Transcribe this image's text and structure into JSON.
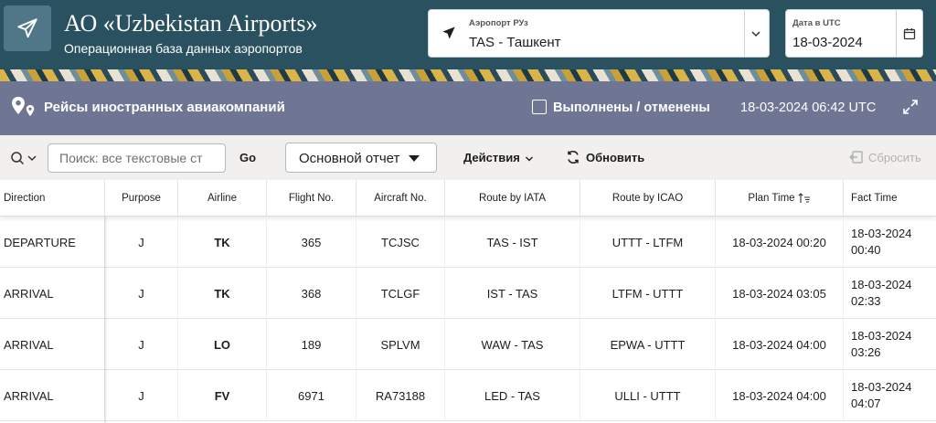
{
  "header": {
    "title": "АО «Uzbekistan Airports»",
    "subtitle": "Операционная база данных аэропортов",
    "airport_label": "Аэропорт РУз",
    "airport_value": "TAS - Ташкент",
    "date_label": "Дата в UTC",
    "date_value": "18-03-2024"
  },
  "region": {
    "title": "Рейсы иностранных авиакомпаний",
    "checkbox_label": "Выполнены / отменены",
    "datetime": "18-03-2024 06:42 UTC"
  },
  "toolbar": {
    "search_placeholder": "Поиск: все текстовые ст",
    "go_label": "Go",
    "report_value": "Основной отчет",
    "actions_label": "Действия",
    "refresh_label": "Обновить",
    "reset_label": "Сбросить"
  },
  "table": {
    "columns": [
      "Direction",
      "Purpose",
      "Airline",
      "Flight No.",
      "Aircraft No.",
      "Route by IATA",
      "Route by ICAO",
      "Plan Time",
      "Fact Time"
    ],
    "rows": [
      {
        "direction": "DEPARTURE",
        "purpose": "J",
        "airline": "TK",
        "flight": "365",
        "aircraft": "TCJSC",
        "iata": "TAS - IST",
        "icao": "UTTT - LTFM",
        "plan": "18-03-2024 00:20",
        "fact_date": "18-03-2024",
        "fact_time": "00:40"
      },
      {
        "direction": "ARRIVAL",
        "purpose": "J",
        "airline": "TK",
        "flight": "368",
        "aircraft": "TCLGF",
        "iata": "IST - TAS",
        "icao": "LTFM - UTTT",
        "plan": "18-03-2024 03:05",
        "fact_date": "18-03-2024",
        "fact_time": "02:33"
      },
      {
        "direction": "ARRIVAL",
        "purpose": "J",
        "airline": "LO",
        "flight": "189",
        "aircraft": "SPLVM",
        "iata": "WAW - TAS",
        "icao": "EPWA - UTTT",
        "plan": "18-03-2024 04:00",
        "fact_date": "18-03-2024",
        "fact_time": "03:26"
      },
      {
        "direction": "ARRIVAL",
        "purpose": "J",
        "airline": "FV",
        "flight": "6971",
        "aircraft": "RA73188",
        "iata": "LED - TAS",
        "icao": "ULLI - UTTT",
        "plan": "18-03-2024 04:00",
        "fact_date": "18-03-2024",
        "fact_time": "04:07"
      }
    ]
  },
  "colors": {
    "header_bg": "#2a5160",
    "region_bg": "#6f7694",
    "toolbar_bg": "#f1f0ee"
  },
  "icons": [
    "send-plane-icon",
    "location-pin-icon",
    "expand-icon",
    "search-icon",
    "chevron-down-icon",
    "calendar-icon",
    "refresh-icon",
    "reset-icon",
    "sort-icon"
  ]
}
